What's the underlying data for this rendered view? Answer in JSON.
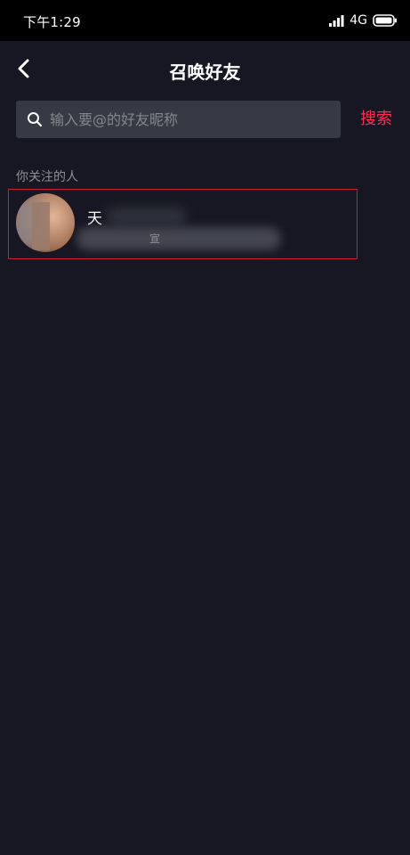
{
  "status_bar": {
    "time": "下午1:29",
    "network": "4G",
    "icons": [
      "signal-icon",
      "battery-icon"
    ]
  },
  "header": {
    "title": "召唤好友",
    "back_icon": "chevron-left-icon"
  },
  "search": {
    "placeholder": "输入要@的好友昵称",
    "value": "",
    "button_label": "搜索",
    "icon": "search-icon"
  },
  "section": {
    "label": "你关注的人"
  },
  "friends": [
    {
      "name": "天",
      "subtitle": "宣"
    }
  ],
  "colors": {
    "background": "#161722",
    "status_bar": "#000000",
    "search_box": "#373944",
    "accent": "#fe2c55",
    "highlight_border": "#c81e2f",
    "muted_text": "#8e8f96"
  }
}
